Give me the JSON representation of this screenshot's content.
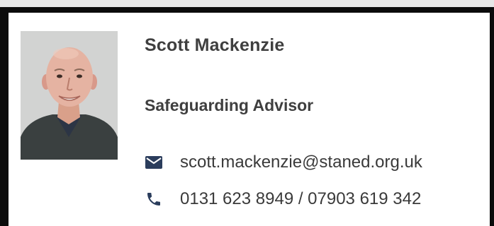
{
  "profile": {
    "name": "Scott Mackenzie",
    "role": "Safeguarding Advisor",
    "email": "scott.mackenzie@staned.org.uk",
    "phone": "0131 623 8949 / 07903 619 342"
  },
  "icons": {
    "email": "envelope-icon",
    "phone": "phone-icon"
  },
  "colors": {
    "icon": "#2b3d5c",
    "text": "#3f3f3f",
    "border": "#0b0b0b"
  }
}
